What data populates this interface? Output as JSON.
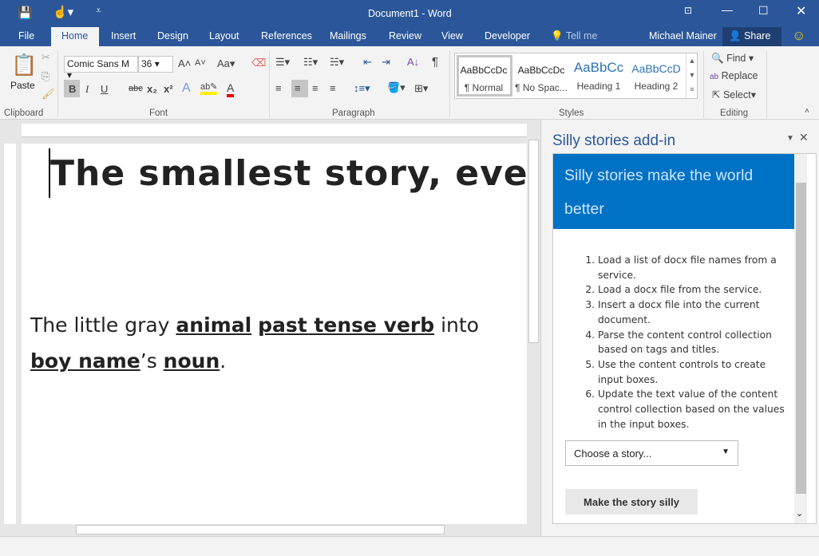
{
  "window": {
    "title": "Document1 - Word"
  },
  "tabs": [
    "File",
    "Home",
    "Insert",
    "Design",
    "Layout",
    "References",
    "Mailings",
    "Review",
    "View",
    "Developer"
  ],
  "tell_me": "Tell me",
  "user": "Michael Mainer",
  "share": "Share",
  "ribbon": {
    "clipboard": {
      "label": "Clipboard",
      "paste": "Paste"
    },
    "font": {
      "label": "Font",
      "name": "Comic Sans M",
      "size": "36",
      "bold": "B",
      "italic": "I",
      "underline": "U",
      "strike": "abc",
      "sub": "x₂",
      "sup": "x²",
      "change_case": "Aa"
    },
    "paragraph": {
      "label": "Paragraph"
    },
    "styles": {
      "label": "Styles",
      "items": [
        {
          "preview": "AaBbCcDc",
          "name": "¶ Normal"
        },
        {
          "preview": "AaBbCcDc",
          "name": "¶ No Spac..."
        },
        {
          "preview": "AaBbCc",
          "name": "Heading 1"
        },
        {
          "preview": "AaBbCcD",
          "name": "Heading 2"
        }
      ]
    },
    "editing": {
      "label": "Editing",
      "find": "Find",
      "replace": "Replace",
      "select": "Select"
    }
  },
  "document": {
    "title": "The smallest story, ever",
    "body": [
      {
        "t": "The little gray ",
        "b": false
      },
      {
        "t": "animal",
        "b": true
      },
      {
        "t": " ",
        "b": false
      },
      {
        "t": "past tense verb",
        "b": true
      },
      {
        "t": " into ",
        "b": false
      },
      {
        "t": "boy name",
        "b": true
      },
      {
        "t": "’s ",
        "b": false
      },
      {
        "t": "noun",
        "b": true
      },
      {
        "t": ".",
        "b": false
      }
    ]
  },
  "pane": {
    "title": "Silly stories add-in",
    "banner": "Silly stories make the world better",
    "steps": [
      "Load a list of docx file names from a service.",
      "Load a docx file from the service.",
      "Insert a docx file into the current document.",
      "Parse the content control collection based on tags and titles.",
      "Use the content controls to create input boxes.",
      "Update the text value of the content control collection based on the values in the input boxes."
    ],
    "dropdown": "Choose a story...",
    "button": "Make the story silly"
  },
  "colors": {
    "brand": "#2b579a",
    "banner": "#0072c6"
  }
}
